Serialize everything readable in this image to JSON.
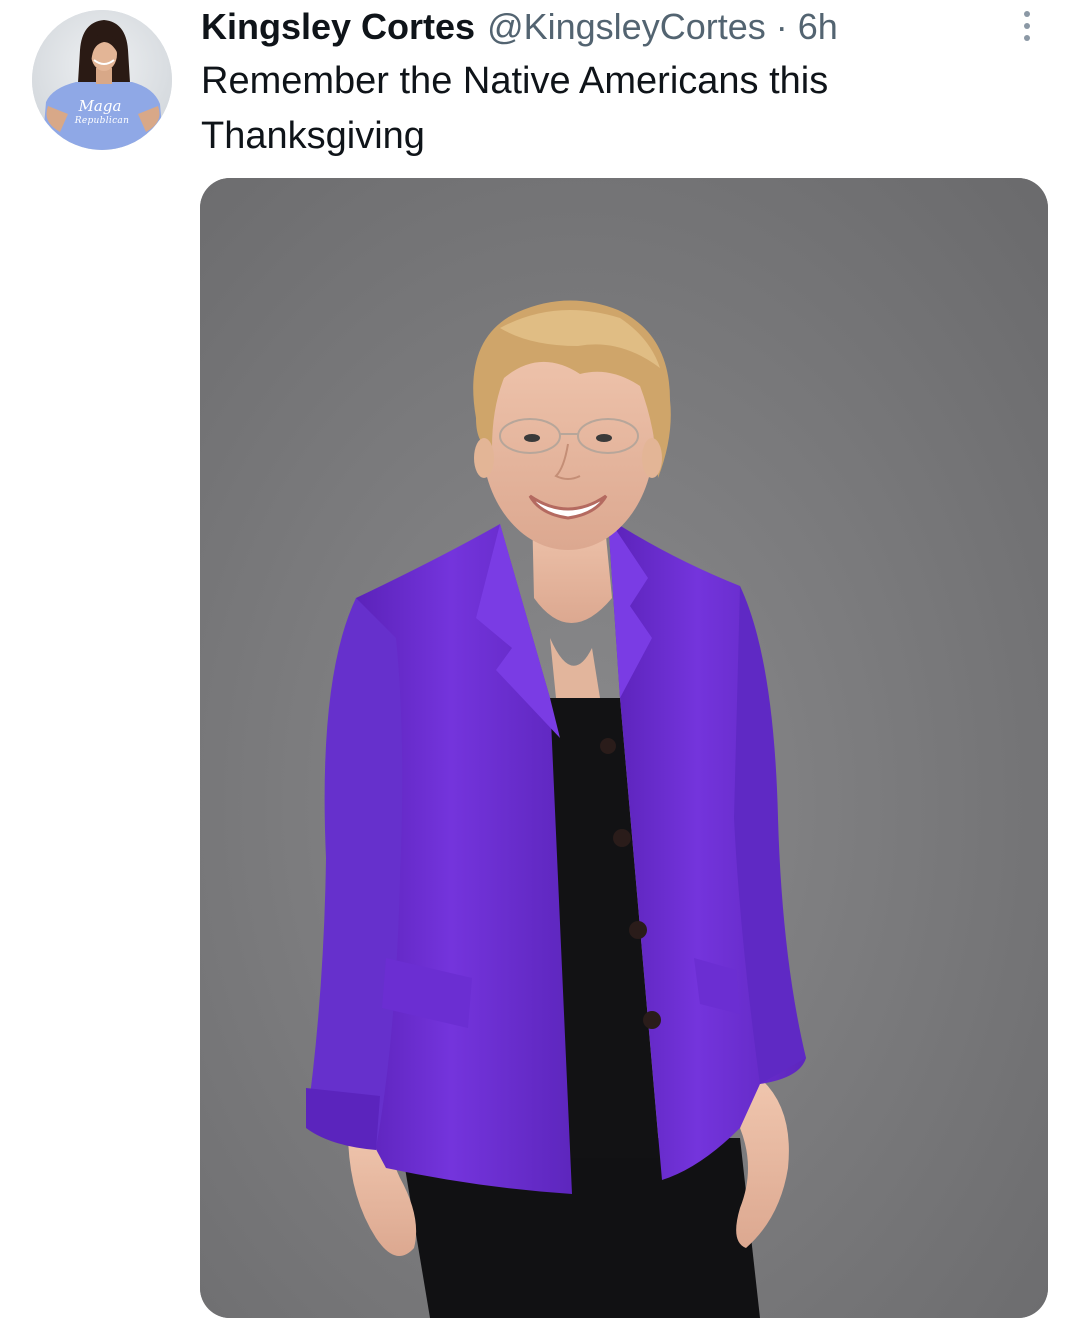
{
  "tweet": {
    "author": {
      "display_name": "Kingsley Cortes",
      "handle": "@KingsleyCortes",
      "avatar_shirt_text_line1": "Maga",
      "avatar_shirt_text_line2": "Republican"
    },
    "separator": "·",
    "time": "6h",
    "text": "Remember the Native Americans this Thanksgiving",
    "more_icon": "more-vertical-icon",
    "media": {
      "kind": "photo",
      "description_icon": "photo-portrait"
    }
  },
  "colors": {
    "text_primary": "#0f1419",
    "text_secondary": "#536471",
    "background": "#ffffff",
    "photo_backdrop": "#7a7a7c",
    "jacket": "#6a2fd0"
  }
}
